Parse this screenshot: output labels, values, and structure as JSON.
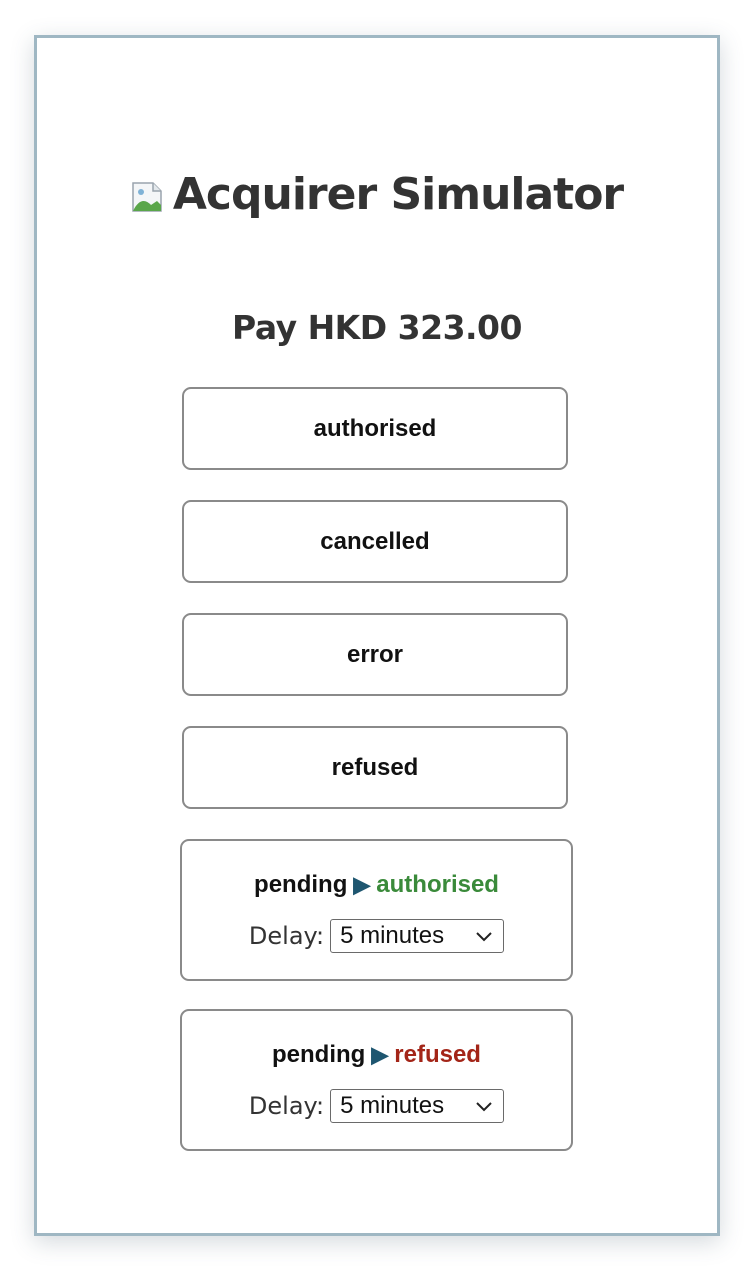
{
  "header": {
    "title": "Acquirer Simulator",
    "logo_icon": "broken-image-icon"
  },
  "payment": {
    "amount_text": "Pay HKD 323.00"
  },
  "buttons": [
    {
      "label": "authorised"
    },
    {
      "label": "cancelled"
    },
    {
      "label": "error"
    },
    {
      "label": "refused"
    }
  ],
  "pending_options": [
    {
      "prefix": "pending",
      "arrow_icon": "play-arrow-icon",
      "outcome": "authorised",
      "outcome_color": "#3a8a3a",
      "delay_label": "Delay:",
      "delay_value": "5 minutes"
    },
    {
      "prefix": "pending",
      "arrow_icon": "play-arrow-icon",
      "outcome": "refused",
      "outcome_color": "#a32518",
      "delay_label": "Delay:",
      "delay_value": "5 minutes"
    }
  ],
  "colors": {
    "card_border": "#9fb7c3",
    "text_dark": "#333333",
    "arrow": "#1e5670"
  }
}
